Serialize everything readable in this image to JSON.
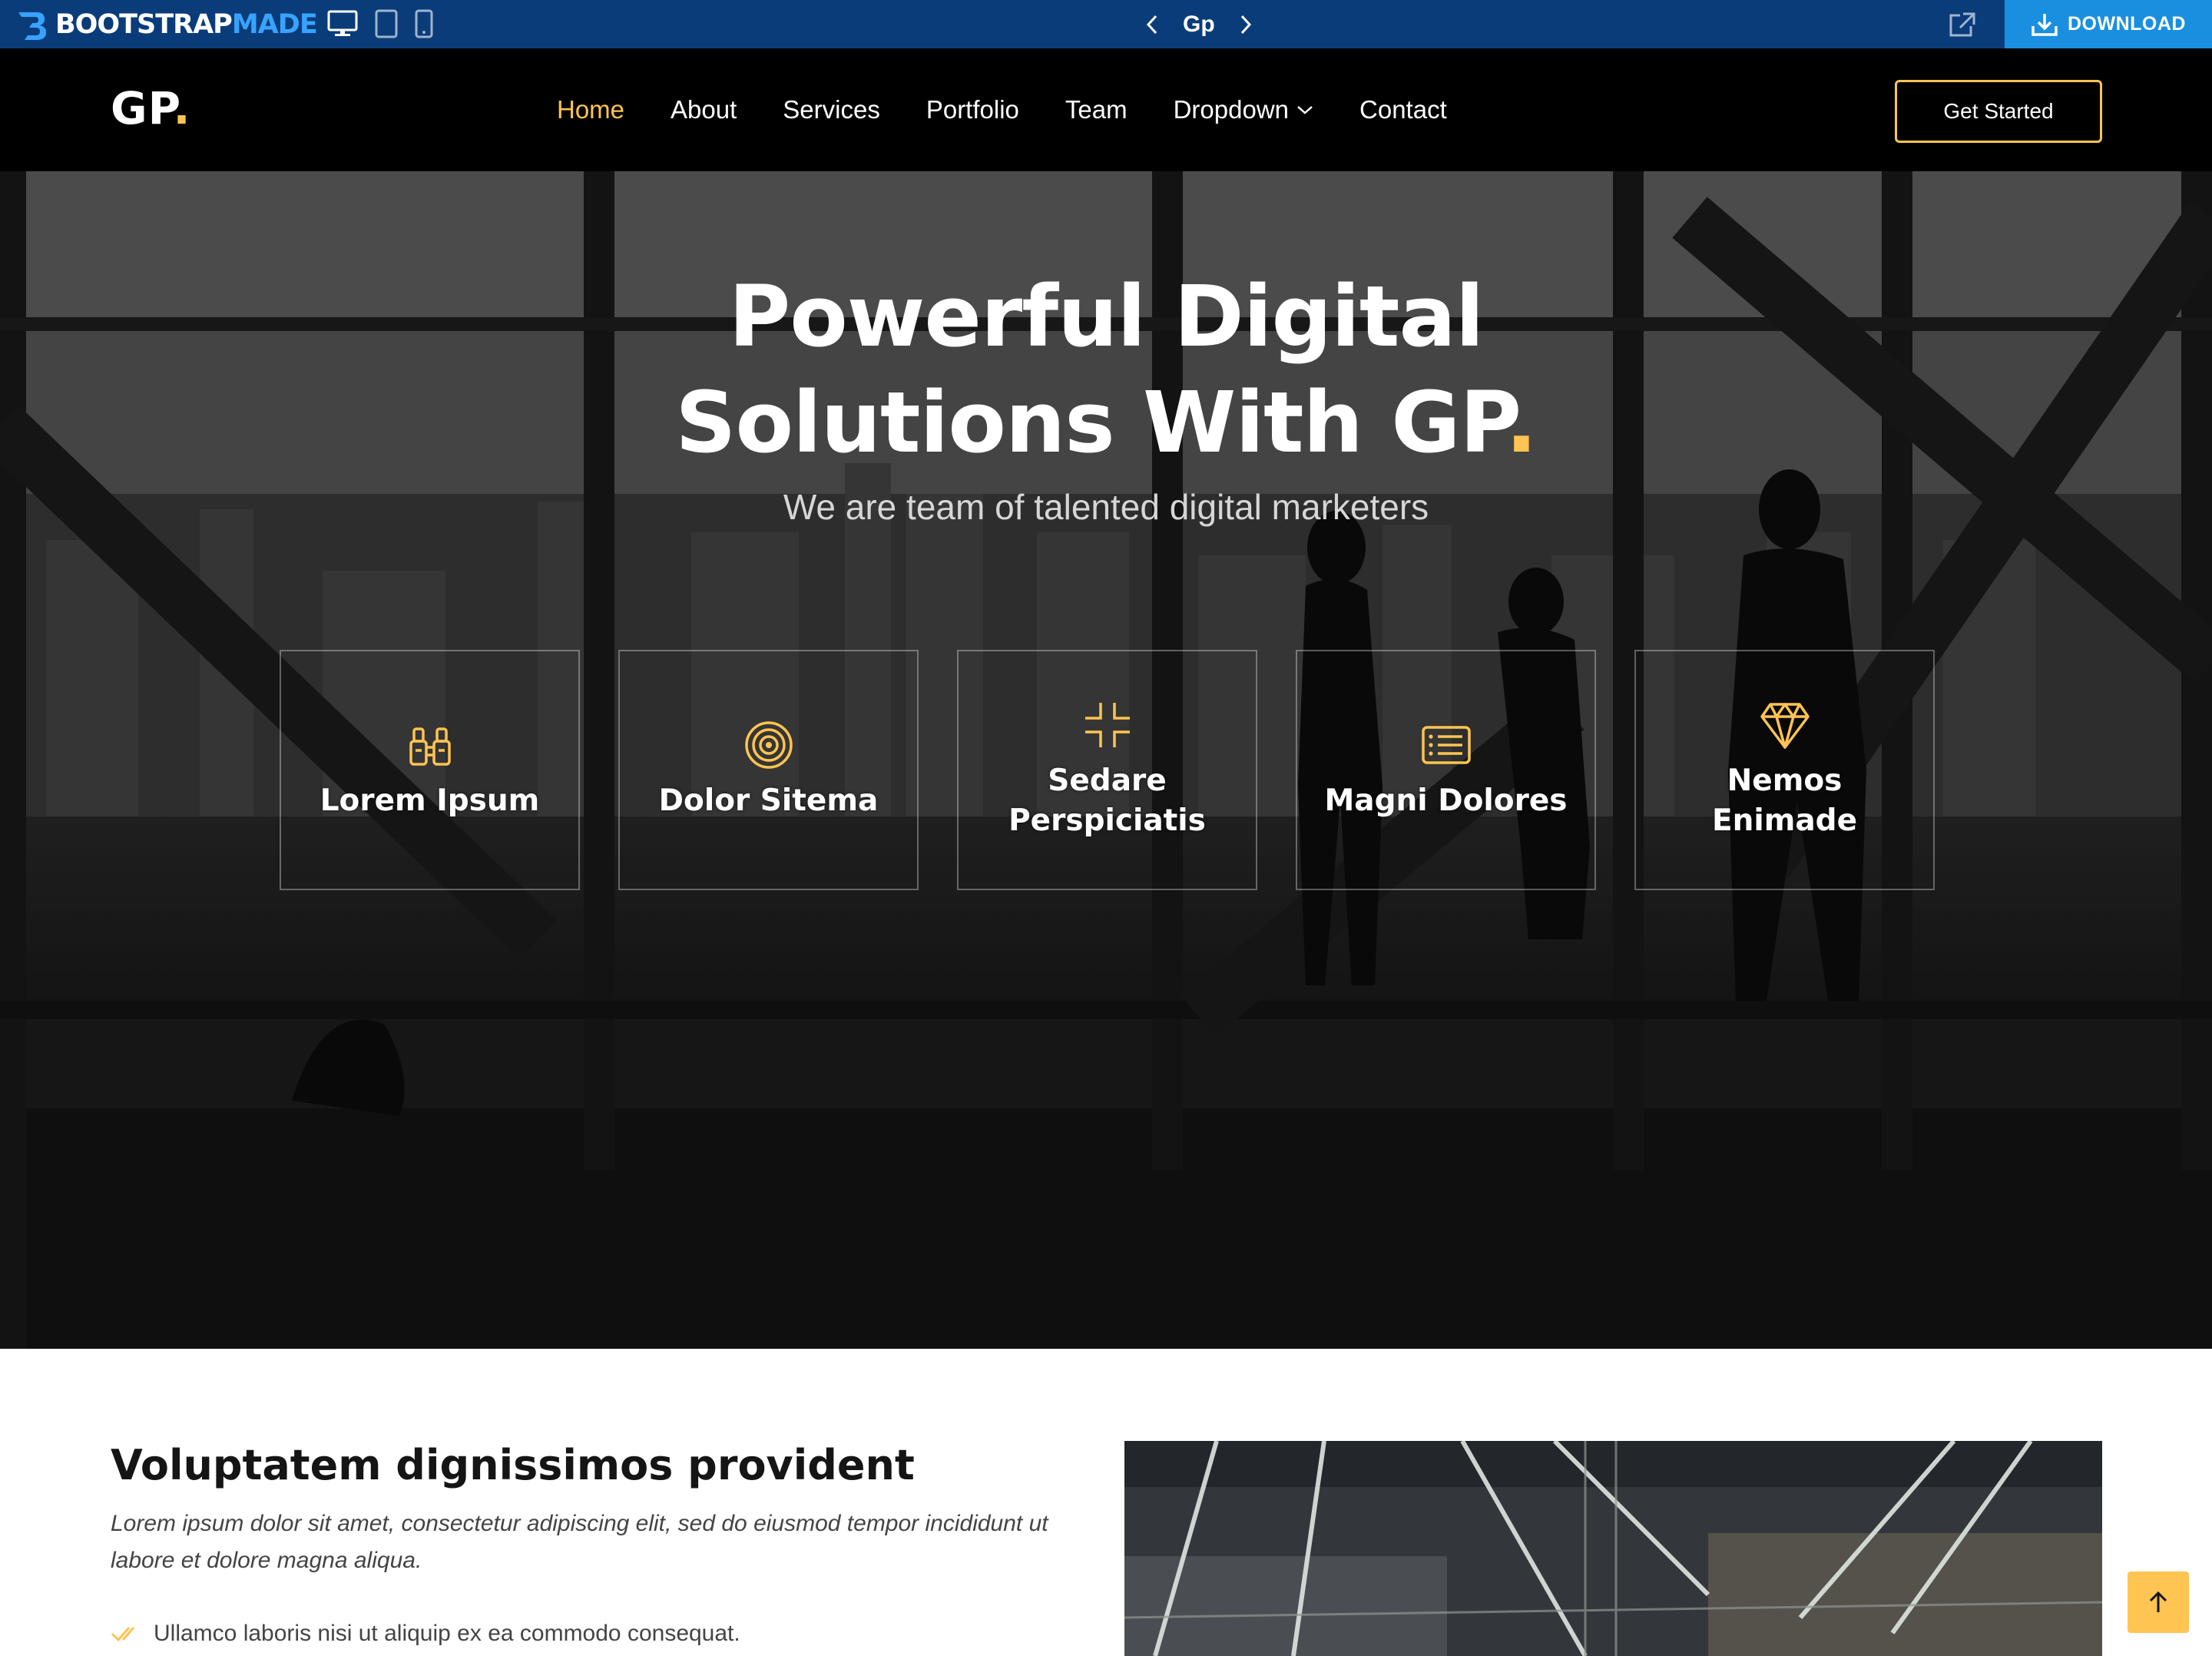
{
  "preview_bar": {
    "brand_left": "BOOTSTRAP",
    "brand_right": "MADE",
    "template_name": "Gp",
    "download_label": "DOWNLOAD",
    "colors": {
      "bar_bg": "#0b3c7a",
      "download_bg": "#1a8fe0",
      "accent": "#38a3ff"
    }
  },
  "header": {
    "logo_text": "GP",
    "logo_dot": ".",
    "nav": [
      {
        "label": "Home",
        "active": true
      },
      {
        "label": "About"
      },
      {
        "label": "Services"
      },
      {
        "label": "Portfolio"
      },
      {
        "label": "Team"
      },
      {
        "label": "Dropdown",
        "icon": "chevron-down-icon"
      },
      {
        "label": "Contact"
      }
    ],
    "cta_label": "Get Started",
    "accent_color": "#ffc451"
  },
  "hero": {
    "title_line1": "Powerful Digital",
    "title_line2": "Solutions With GP",
    "title_dot": ".",
    "subtitle": "We are team of talented digital marketers",
    "features": [
      {
        "icon": "binoculars-icon",
        "label": "Lorem Ipsum"
      },
      {
        "icon": "target-icon",
        "label": "Dolor Sitema"
      },
      {
        "icon": "fullscreen-exit-icon",
        "label": "Sedare Perspiciatis"
      },
      {
        "icon": "card-list-icon",
        "label": "Magni Dolores"
      },
      {
        "icon": "gem-icon",
        "label": "Nemos Enimade"
      }
    ]
  },
  "about": {
    "title": "Voluptatem dignissimos provident",
    "lead": "Lorem ipsum dolor sit amet, consectetur adipiscing elit, sed do eiusmod tempor incididunt ut labore et dolore magna aliqua.",
    "checklist": [
      "Ullamco laboris nisi ut aliquip ex ea commodo consequat."
    ]
  }
}
